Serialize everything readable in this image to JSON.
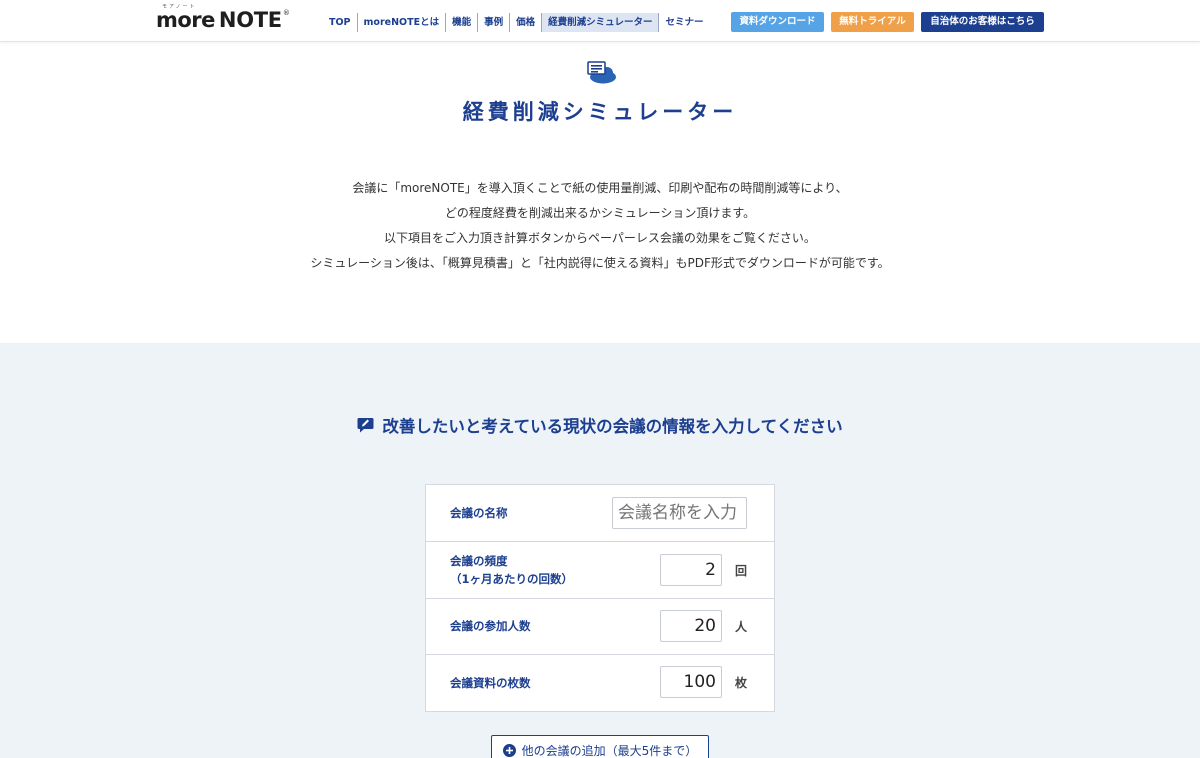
{
  "header": {
    "logo": {
      "brand": "more",
      "product": "NOTE",
      "mark": "®",
      "tagline": "モアノート"
    },
    "nav": [
      {
        "label": "TOP"
      },
      {
        "label": "moreNOTEとは"
      },
      {
        "label": "機能"
      },
      {
        "label": "事例"
      },
      {
        "label": "価格"
      },
      {
        "label": "経費削減シミュレーター",
        "active": true
      },
      {
        "label": "セミナー"
      }
    ],
    "buttons": {
      "download": "資料ダウンロード",
      "trial": "無料トライアル",
      "government": "自治体のお客様はこちら"
    }
  },
  "title": {
    "icon": "document-cloud-icon",
    "text": "経費削減シミュレーター"
  },
  "intro": [
    "会議に「moreNOTE」を導入頂くことで紙の使用量削減、印刷や配布の時間削減等により、",
    "どの程度経費を削減出来るかシミュレーション頂けます。",
    "以下項目をご入力頂き計算ボタンからペーパーレス会議の効果をご覧ください。",
    "シミュレーション後は、「概算見積書」と「社内説得に使える資料」もPDF形式でダウンロードが可能です。"
  ],
  "form": {
    "heading": "改善したいと考えている現状の会議の情報を入力してください",
    "heading_icon": "edit-icon",
    "rows": {
      "name": {
        "label": "会議の名称",
        "placeholder": "会議名称を入力"
      },
      "frequency": {
        "label_line1": "会議の頻度",
        "label_line2": "（1ヶ月あたりの回数）",
        "value": "2",
        "unit": "回"
      },
      "participants": {
        "label": "会議の参加人数",
        "value": "20",
        "unit": "人"
      },
      "pages": {
        "label": "会議資料の枚数",
        "value": "100",
        "unit": "枚"
      }
    },
    "add_button": "他の会議の追加（最大5件まで）"
  },
  "colors": {
    "primary": "#1d3f8f",
    "download_btn": "#56a4e6",
    "trial_btn": "#f0a048",
    "section_bg": "#eef3f8"
  }
}
